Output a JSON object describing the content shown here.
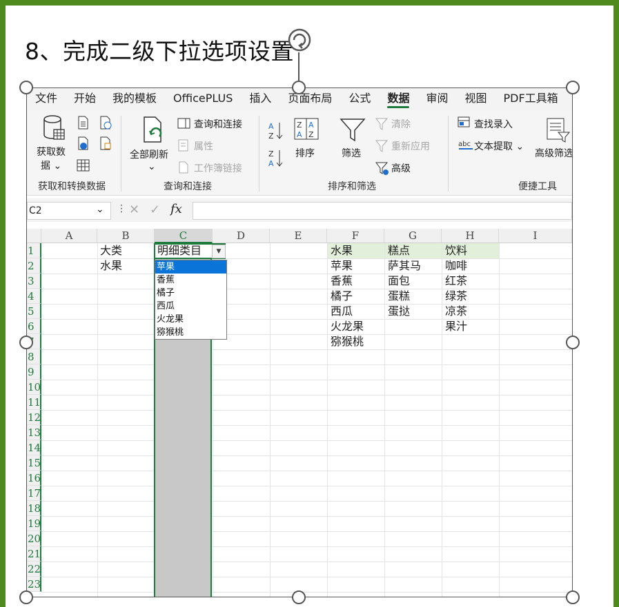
{
  "slide": {
    "title": "8、完成二级下拉选项设置"
  },
  "menu": {
    "items": [
      "文件",
      "开始",
      "我的模板",
      "OfficePLUS",
      "插入",
      "页面布局",
      "公式",
      "数据",
      "审阅",
      "视图",
      "PDF工具箱"
    ],
    "active": "数据"
  },
  "ribbon": {
    "get_data": "获取数",
    "get_data2": "据 ⌄",
    "refresh_all": "全部刷新",
    "refresh_caret": "⌄",
    "query_connect": "查询和连接",
    "properties": "属性",
    "workbook_links": "工作簿链接",
    "sort_label": "排序",
    "filter_label": "筛选",
    "clear": "清除",
    "reapply": "重新应用",
    "advanced": "高级",
    "find_entry": "查找录入",
    "text_extract": "文本提取 ⌄",
    "advanced_filter": "高级筛选",
    "groups": {
      "get_transform": "获取和转换数据",
      "queries": "查询和连接",
      "sort_filter": "排序和筛选",
      "tools": "便捷工具"
    }
  },
  "formula_bar": {
    "name_box": "C2",
    "fx": "fx",
    "value": ""
  },
  "sheet": {
    "columns": [
      "A",
      "B",
      "C",
      "D",
      "E",
      "F",
      "G",
      "H",
      "I"
    ],
    "rows": [
      "1",
      "2",
      "3",
      "4",
      "5",
      "6",
      "7",
      "8",
      "9",
      "10",
      "11",
      "12",
      "13",
      "14",
      "15",
      "16",
      "17",
      "18",
      "19",
      "20",
      "21",
      "22",
      "23"
    ],
    "b1": "大类",
    "c1": "明细类目",
    "b2": "水果",
    "f_col": [
      "水果",
      "苹果",
      "香蕉",
      "橘子",
      "西瓜",
      "火龙果",
      "猕猴桃"
    ],
    "g_col": [
      "糕点",
      "萨其马",
      "面包",
      "蛋糕",
      "蛋挞"
    ],
    "h_col": [
      "饮料",
      "咖啡",
      "红茶",
      "绿茶",
      "凉茶",
      "果汁"
    ]
  },
  "dropdown": {
    "options": [
      "苹果",
      "香蕉",
      "橘子",
      "西瓜",
      "火龙果",
      "猕猴桃"
    ],
    "highlighted": "苹果"
  },
  "colors": {
    "frame": "#4f8a1f",
    "accent": "#1f7a3d",
    "header_fill": "#e2efda",
    "dropdown_highlight": "#0b74d9"
  }
}
